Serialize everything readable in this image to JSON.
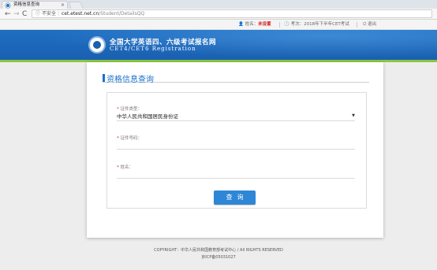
{
  "browser": {
    "tab_title": "资格信息查询",
    "tab_close": "×",
    "url_secure_label": "不安全",
    "url_domain": "cet.etest.net.cn",
    "url_path": "/Student/DetailsQQ",
    "back_glyph": "←",
    "forward_glyph": "→",
    "reload_glyph": "C",
    "info_glyph": "ⓘ"
  },
  "topbar": {
    "name_label": "姓名：",
    "name_value": "未设置",
    "exam_label": "考次：2018年下半年CET考试",
    "exit_label": "退出"
  },
  "banner": {
    "title": "全国大学英语四、六级考试报名网",
    "subtitle": "CET4/CET6  Registration"
  },
  "main": {
    "page_title": "资格信息查询",
    "fields": [
      {
        "label": "证件类型：",
        "value": "中华人民共和国居民身份证",
        "required": "*"
      },
      {
        "label": "证件号码：",
        "value": "",
        "required": "*"
      },
      {
        "label": "姓名：",
        "value": "",
        "required": "*"
      }
    ],
    "caret": "▼",
    "query_button": "查询"
  },
  "footer": {
    "copyright": "COPYRIGHT：中华人民共和国教育部考试中心 / All RIGHTS RESERVED",
    "icp": "京ICP备05031027"
  },
  "colors": {
    "banner": "#1a5fb0",
    "accent": "#1a73c9",
    "button": "#2e86d6",
    "required": "#d41c1c",
    "green_rule": "#8dc63f"
  }
}
